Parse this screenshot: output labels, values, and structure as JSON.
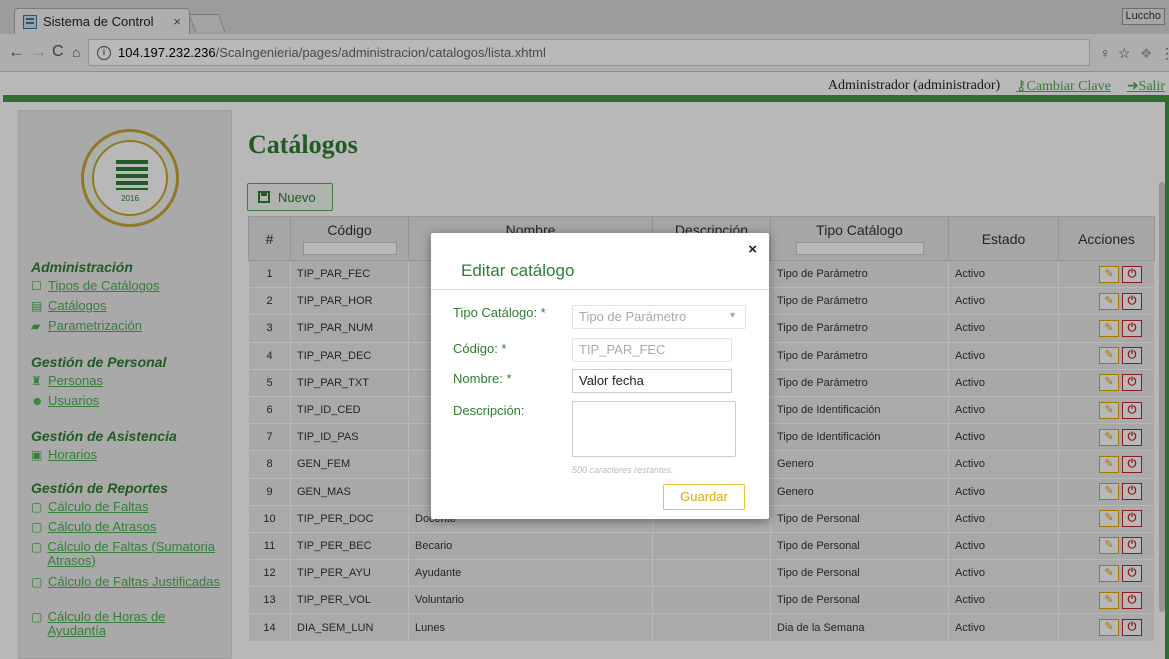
{
  "browser": {
    "tab_title": "Sistema de Control",
    "tab_close": "×",
    "profile": "Luccho",
    "url_host": "104.197.232.236",
    "url_path": "/ScaIngenieria/pages/administracion/catalogos/lista.xhtml"
  },
  "header": {
    "user": "Administrador (administrador)",
    "change_password": "Cambiar Clave",
    "logout": "Salir"
  },
  "logo": {
    "year": "2016"
  },
  "sidebar": {
    "sections": [
      {
        "title": "Administración",
        "items": [
          {
            "icon": "bookmark-icon",
            "label": "Tipos de Catálogos"
          },
          {
            "icon": "list-icon",
            "label": "Catálogos"
          },
          {
            "icon": "book-icon",
            "label": "Parametrización"
          }
        ]
      },
      {
        "title": "Gestión de Personal",
        "items": [
          {
            "icon": "person-icon",
            "label": "Personas"
          },
          {
            "icon": "users-icon",
            "label": "Usuarios"
          }
        ]
      },
      {
        "title": "Gestión de Asistencia",
        "items": [
          {
            "icon": "calendar-icon",
            "label": "Horarios"
          }
        ]
      },
      {
        "title": "Gestión de Reportes",
        "items": [
          {
            "icon": "pdf-icon",
            "label": "Cálculo de Faltas"
          },
          {
            "icon": "pdf-icon",
            "label": "Cálculo de Atrasos"
          },
          {
            "icon": "pdf-icon",
            "label": "Cálculo de Faltas (Sumatoria Atrasos)"
          },
          {
            "icon": "pdf-icon",
            "label": "Cálculo de Faltas Justificadas"
          },
          {
            "icon": "pdf-icon",
            "label": "Cálculo de Horas de Ayudantía"
          }
        ]
      }
    ]
  },
  "main": {
    "title": "Catálogos",
    "new_button": "Nuevo",
    "columns": [
      "#",
      "Código",
      "Nombre",
      "Descripción",
      "Tipo Catálogo",
      "Estado",
      "Acciones"
    ],
    "rows": [
      [
        "1",
        "TIP_PAR_FEC",
        "",
        "",
        "Tipo de Parámetro",
        "Activo"
      ],
      [
        "2",
        "TIP_PAR_HOR",
        "",
        "",
        "Tipo de Parámetro",
        "Activo"
      ],
      [
        "3",
        "TIP_PAR_NUM",
        "",
        "",
        "Tipo de Parámetro",
        "Activo"
      ],
      [
        "4",
        "TIP_PAR_DEC",
        "",
        "",
        "Tipo de Parámetro",
        "Activo"
      ],
      [
        "5",
        "TIP_PAR_TXT",
        "",
        "",
        "Tipo de Parámetro",
        "Activo"
      ],
      [
        "6",
        "TIP_ID_CED",
        "",
        "",
        "Tipo de Identificación",
        "Activo"
      ],
      [
        "7",
        "TIP_ID_PAS",
        "",
        "",
        "Tipo de Identificación",
        "Activo"
      ],
      [
        "8",
        "GEN_FEM",
        "",
        "",
        "Genero",
        "Activo"
      ],
      [
        "9",
        "GEN_MAS",
        "",
        "",
        "Genero",
        "Activo"
      ],
      [
        "10",
        "TIP_PER_DOC",
        "Docente",
        "",
        "Tipo de Personal",
        "Activo"
      ],
      [
        "11",
        "TIP_PER_BEC",
        "Becario",
        "",
        "Tipo de Personal",
        "Activo"
      ],
      [
        "12",
        "TIP_PER_AYU",
        "Ayudante",
        "",
        "Tipo de Personal",
        "Activo"
      ],
      [
        "13",
        "TIP_PER_VOL",
        "Voluntario",
        "",
        "Tipo de Personal",
        "Activo"
      ],
      [
        "14",
        "DIA_SEM_LUN",
        "Lunes",
        "",
        "Dia de la Semana",
        "Activo"
      ]
    ]
  },
  "modal": {
    "title": "Editar catálogo",
    "close": "×",
    "tipo_label": "Tipo Catálogo: *",
    "tipo_value": "Tipo de Parámetro",
    "codigo_label": "Código: *",
    "codigo_value": "TIP_PAR_FEC",
    "nombre_label": "Nombre: *",
    "nombre_value": "Valor fecha",
    "descripcion_label": "Descripción:",
    "descripcion_value": "",
    "chars_remaining": "500 caracteres restantes.",
    "save": "Guardar"
  }
}
